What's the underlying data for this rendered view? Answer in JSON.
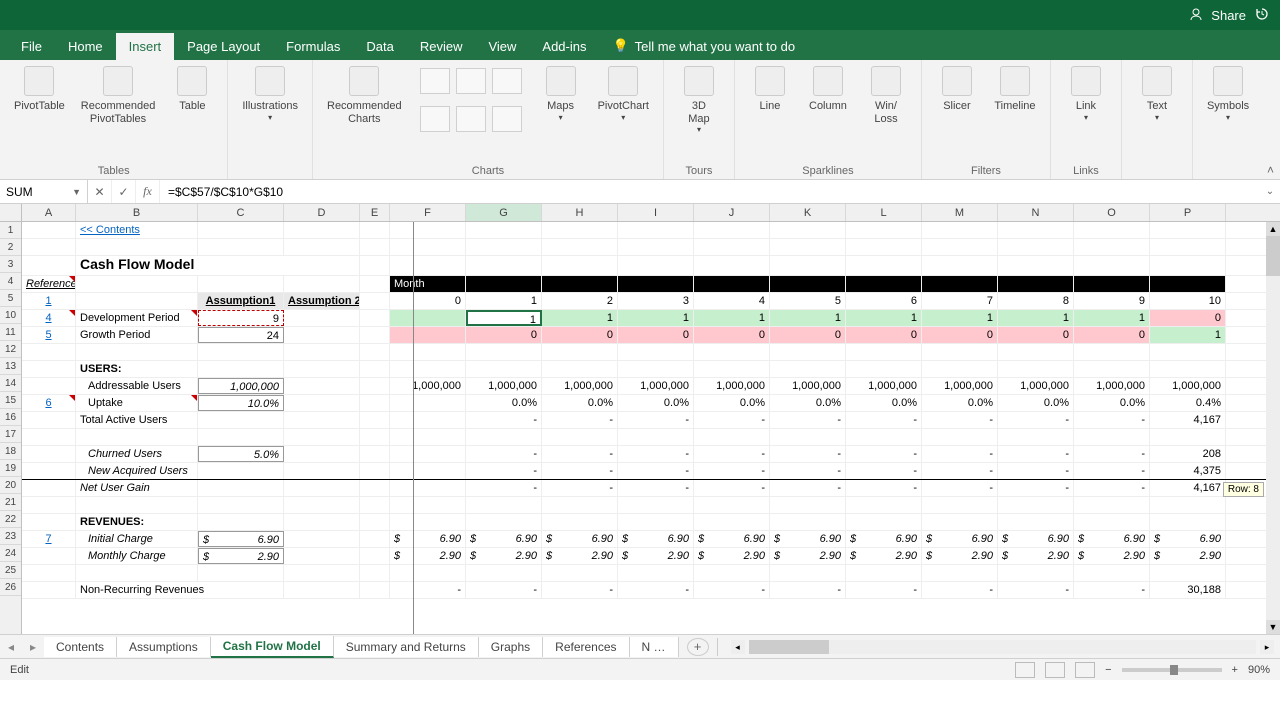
{
  "titlebar": {
    "share": "Share"
  },
  "tabs": [
    "File",
    "Home",
    "Insert",
    "Page Layout",
    "Formulas",
    "Data",
    "Review",
    "View",
    "Add-ins"
  ],
  "tellme": "Tell me what you want to do",
  "active_tab": "Insert",
  "ribbon": {
    "tables": {
      "label": "Tables",
      "pivottable": "PivotTable",
      "recpivot": "Recommended\nPivotTables",
      "table": "Table"
    },
    "illus": {
      "label": "",
      "illustrations": "Illustrations"
    },
    "charts": {
      "label": "Charts",
      "rec": "Recommended\nCharts",
      "maps": "Maps",
      "pivotchart": "PivotChart"
    },
    "tours": {
      "label": "Tours",
      "map3d": "3D\nMap"
    },
    "sparklines": {
      "label": "Sparklines",
      "line": "Line",
      "column": "Column",
      "winloss": "Win/\nLoss"
    },
    "filters": {
      "label": "Filters",
      "slicer": "Slicer",
      "timeline": "Timeline"
    },
    "links": {
      "label": "Links",
      "link": "Link"
    },
    "text": {
      "label": "",
      "text": "Text"
    },
    "symbols": {
      "label": "",
      "symbols": "Symbols"
    }
  },
  "namebox": "SUM",
  "formula": "=$C$57/$C$10*G$10",
  "columns": [
    "A",
    "B",
    "C",
    "D",
    "E",
    "F",
    "G",
    "H",
    "I",
    "J",
    "K",
    "L",
    "M",
    "N",
    "O",
    "P"
  ],
  "row_nums": [
    "1",
    "2",
    "3",
    "4",
    "5",
    "10",
    "11",
    "12",
    "13",
    "14",
    "15",
    "16",
    "17",
    "18",
    "19",
    "20",
    "21",
    "22",
    "23",
    "24",
    "25",
    "26"
  ],
  "sheet": {
    "contents_link": "<< Contents",
    "title": "Cash Flow Model",
    "reference": "Reference",
    "assump1": "Assumption1",
    "assump2": "Assumption 2",
    "month": "Month",
    "ref1": "1",
    "ref4": "4",
    "ref5": "5",
    "ref6": "6",
    "ref7": "7",
    "dev_period": "Development Period",
    "dev_val": "9",
    "growth": "Growth Period",
    "growth_val": "24",
    "users_hdr": "USERS:",
    "addr_users": "Addressable Users",
    "addr_val": "1,000,000",
    "uptake": "Uptake",
    "uptake_val": "10.0%",
    "total_active": "Total Active Users",
    "churned": "Churned Users",
    "churned_val": "5.0%",
    "new_acq": "New Acquired Users",
    "net_gain": "Net User Gain",
    "rev_hdr": "REVENUES:",
    "init_charge": "Initial Charge",
    "init_val": "6.90",
    "dollar": "$",
    "mon_charge": "Monthly Charge",
    "mon_val": "2.90",
    "nonrec": "Non-Recurring Revenues",
    "months": [
      "0",
      "1",
      "2",
      "3",
      "4",
      "5",
      "6",
      "7",
      "8",
      "9",
      "10"
    ],
    "dev_row": [
      "",
      "1",
      "1",
      "1",
      "1",
      "1",
      "1",
      "1",
      "1",
      "1",
      "0"
    ],
    "growth_row": [
      "",
      "0",
      "0",
      "0",
      "0",
      "0",
      "0",
      "0",
      "0",
      "0",
      "1"
    ],
    "addr_row": [
      "1,000,000",
      "1,000,000",
      "1,000,000",
      "1,000,000",
      "1,000,000",
      "1,000,000",
      "1,000,000",
      "1,000,000",
      "1,000,000",
      "1,000,000",
      "1,000,000"
    ],
    "uptake_row": [
      "",
      "0.0%",
      "0.0%",
      "0.0%",
      "0.0%",
      "0.0%",
      "0.0%",
      "0.0%",
      "0.0%",
      "0.0%",
      "0.4%"
    ],
    "total_row": [
      "",
      "-",
      "-",
      "-",
      "-",
      "-",
      "-",
      "-",
      "-",
      "-",
      "4,167"
    ],
    "churn_row": [
      "",
      "-",
      "-",
      "-",
      "-",
      "-",
      "-",
      "-",
      "-",
      "-",
      "208"
    ],
    "newacq_row": [
      "",
      "-",
      "-",
      "-",
      "-",
      "-",
      "-",
      "-",
      "-",
      "-",
      "4,375"
    ],
    "netgain_row": [
      "",
      "-",
      "-",
      "-",
      "-",
      "-",
      "-",
      "-",
      "-",
      "-",
      "4,167"
    ],
    "init_row_val": "6.90",
    "mon_row_val": "2.90",
    "nonrec_p": "30,188",
    "edit_cell": "1"
  },
  "sheettabs": [
    "Contents",
    "Assumptions",
    "Cash Flow Model",
    "Summary and Returns",
    "Graphs",
    "References",
    "N …"
  ],
  "active_sheet": "Cash Flow Model",
  "status": "Edit",
  "zoom": "90%",
  "scroll_tip": "Row: 8"
}
